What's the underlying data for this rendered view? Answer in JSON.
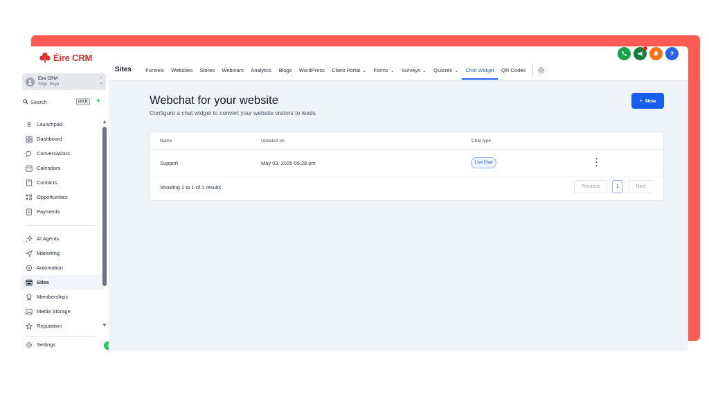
{
  "brand": {
    "name": "Éire CRM"
  },
  "account": {
    "name": "Eire CRM",
    "location": "Sligo, Sligo"
  },
  "search": {
    "label": "Search",
    "shortcut": "ctrl K"
  },
  "sidebar": {
    "items": [
      {
        "label": "Launchpad",
        "icon": "rocket-icon"
      },
      {
        "label": "Dashboard",
        "icon": "grid-icon"
      },
      {
        "label": "Conversations",
        "icon": "chat-icon"
      },
      {
        "label": "Calendars",
        "icon": "calendar-icon"
      },
      {
        "label": "Contacts",
        "icon": "contacts-icon"
      },
      {
        "label": "Opportunities",
        "icon": "opportunities-icon"
      },
      {
        "label": "Payments",
        "icon": "payments-icon"
      },
      {
        "label": "AI Agents",
        "icon": "sparkle-icon"
      },
      {
        "label": "Marketing",
        "icon": "send-icon"
      },
      {
        "label": "Automation",
        "icon": "automation-icon"
      },
      {
        "label": "Sites",
        "icon": "sites-icon",
        "active": true
      },
      {
        "label": "Memberships",
        "icon": "award-icon"
      },
      {
        "label": "Media Storage",
        "icon": "image-icon"
      },
      {
        "label": "Reputation",
        "icon": "star-icon"
      },
      {
        "label": "Settings",
        "icon": "gear-icon"
      }
    ]
  },
  "topbar": {
    "title": "Sites",
    "tabs": [
      {
        "label": "Funnels"
      },
      {
        "label": "Websites"
      },
      {
        "label": "Stores"
      },
      {
        "label": "Webinars"
      },
      {
        "label": "Analytics"
      },
      {
        "label": "Blogs"
      },
      {
        "label": "WordPress"
      },
      {
        "label": "Client Portal",
        "dropdown": true
      },
      {
        "label": "Forms",
        "dropdown": true
      },
      {
        "label": "Surveys",
        "dropdown": true
      },
      {
        "label": "Quizzes",
        "dropdown": true
      },
      {
        "label": "Chat Widget",
        "active": true
      },
      {
        "label": "QR Codes"
      }
    ],
    "icons": [
      {
        "name": "phone-icon",
        "color": "#16a34a"
      },
      {
        "name": "megaphone-icon",
        "color": "#15803d"
      },
      {
        "name": "bell-icon",
        "color": "#f97316"
      },
      {
        "name": "help-icon",
        "color": "#2563eb",
        "text": "?"
      }
    ]
  },
  "main": {
    "title": "Webchat for your website",
    "subtitle": "Configure a chat widget to convert your website visitors to leads",
    "new_button": "New",
    "table": {
      "columns": [
        "Name",
        "Updated on",
        "Chat type"
      ],
      "rows": [
        {
          "name": "Support",
          "updated": "May 03, 2025 06:28 pm",
          "chat_type": "Live Chat"
        }
      ],
      "results": "Showing 1 to 1 of 1 results",
      "pagination": {
        "previous": "Previous",
        "current": "1",
        "next": "Next"
      }
    }
  },
  "colors": {
    "frame": "#ff5a54",
    "accent": "#155eef",
    "brand": "#d6302d"
  }
}
